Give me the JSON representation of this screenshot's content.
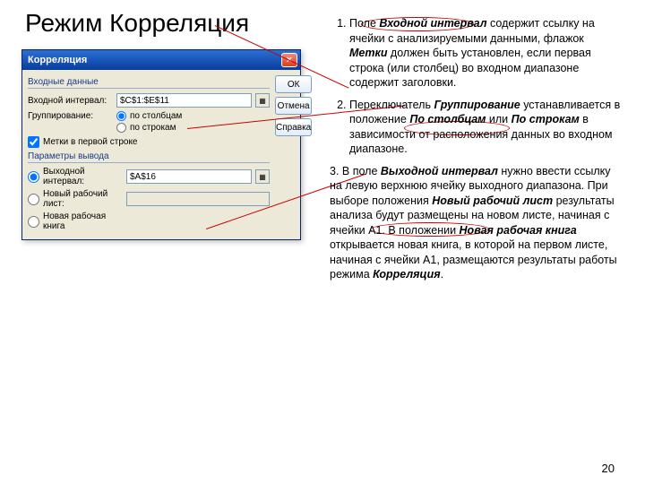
{
  "slide": {
    "title": "Режим Корреляция",
    "page_number": "20"
  },
  "dialog": {
    "title": "Корреляция",
    "close": "×",
    "sections": {
      "input": {
        "title": "Входные данные",
        "interval_label": "Входной интервал:",
        "interval_value": "$C$1:$E$11",
        "grouping_label": "Группирование:",
        "by_columns": "по столбцам",
        "by_rows": "по строкам",
        "labels_first_row": "Метки в первой строке"
      },
      "output": {
        "title": "Параметры вывода",
        "output_range": "Выходной интервал:",
        "output_value": "$A$16",
        "new_ws": "Новый рабочий лист:",
        "new_wb": "Новая рабочая книга"
      }
    },
    "buttons": {
      "ok": "ОК",
      "cancel": "Отмена",
      "help": "Справка"
    }
  },
  "explain": {
    "p1_pre": "Поле ",
    "p1_b1": "Входной интервал",
    "p1_mid1": " содержит ссылку на ячейки с анализируемыми данными, флажок ",
    "p1_b2": "Метки",
    "p1_post": " должен быть установлен, если первая строка (или столбец) во входном диапазоне содержит заголовки.",
    "p2_pre": "Переключатель ",
    "p2_b1": "Группирование",
    "p2_mid1": " устанавливается в положение ",
    "p2_b2": "По столбцам",
    "p2_mid2": " или ",
    "p2_b3": "По строкам",
    "p2_post": " в зависимости от расположения данных во входном диапазоне.",
    "p3_pre": "3. В поле ",
    "p3_b1": "Выходной интервал",
    "p3_mid1": " нужно ввести ссылку на левую верхнюю ячейку выходного диапазона. При выборе положения ",
    "p3_b2": "Новый рабочий лист",
    "p3_mid2": " результаты анализа будут размещены на новом листе, начиная с ячейки А1. В положении ",
    "p3_b3": "Новая рабочая книга",
    "p3_mid3": " открывается новая книга, в которой на первом листе, начиная с ячейки А1, размещаются результаты работы режима ",
    "p3_b4": "Корреляция",
    "p3_post": "."
  }
}
